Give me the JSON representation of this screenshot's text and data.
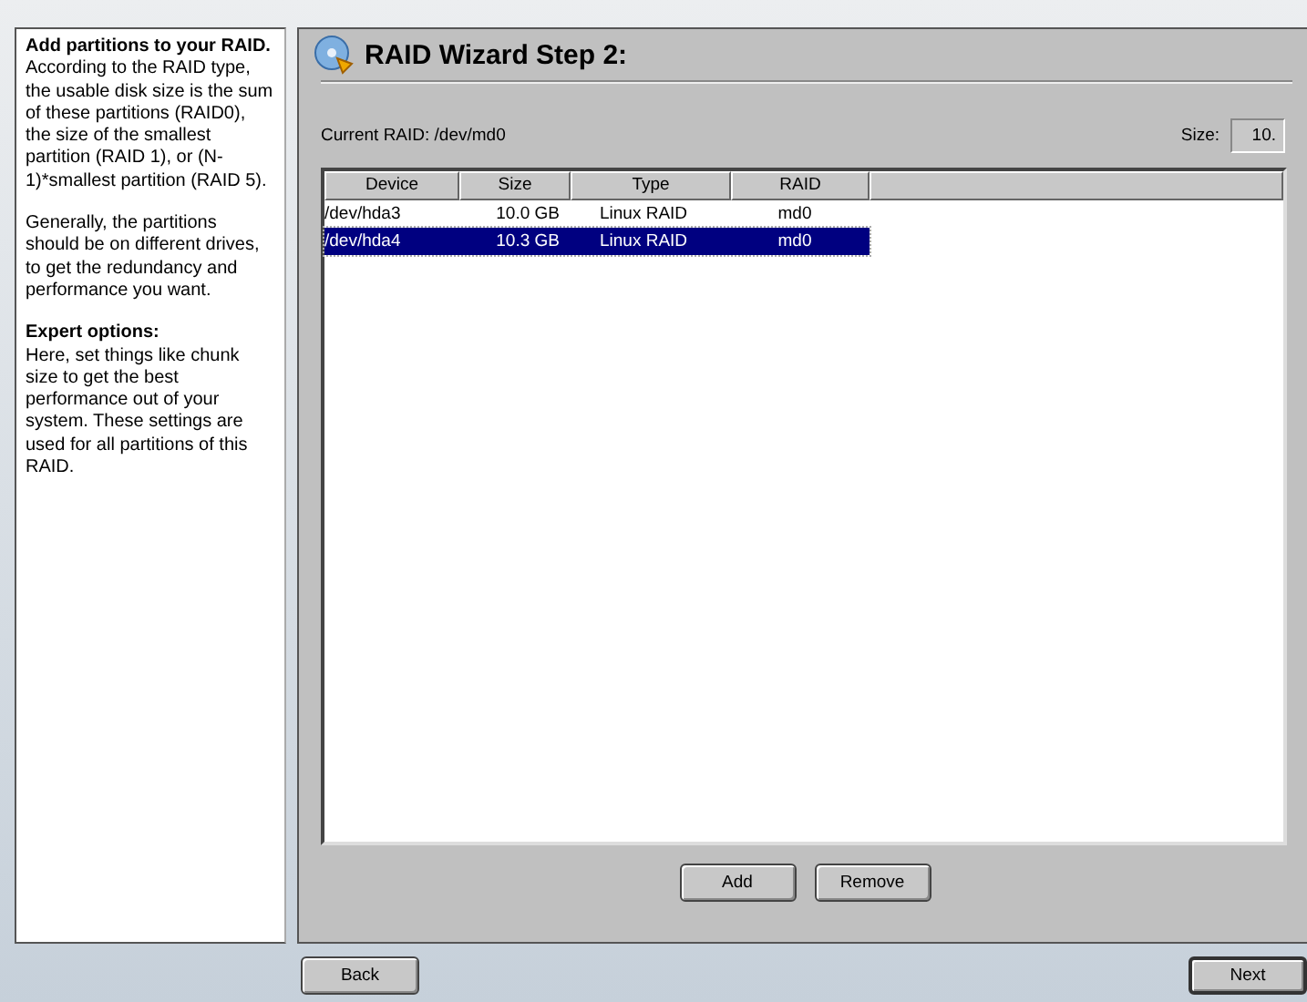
{
  "help": {
    "paragraphs": [
      "**Add partitions to your RAID.** According to the RAID type, the usable disk size is the sum of these partitions (RAID0), the size of the smallest partition (RAID 1), or (N-1)*smallest partition (RAID 5).",
      "Generally, the partitions should be on different drives, to get the redundancy and performance you want.",
      "**Expert options:**\nHere, set things like chunk size to get the best performance out of your system. These settings are used for all partitions of this RAID."
    ]
  },
  "title": "RAID Wizard Step 2:",
  "current_raid": "Current RAID: /dev/md0",
  "size": {
    "label": "Size:",
    "value": "10."
  },
  "table": {
    "columns": [
      "Device",
      "Size",
      "Type",
      "RAID"
    ],
    "rows": [
      {
        "cells": [
          "/dev/hda3",
          "10.0 GB",
          "Linux RAID",
          "md0"
        ],
        "selected": false
      },
      {
        "cells": [
          "/dev/hda4",
          "10.3 GB",
          "Linux RAID",
          "md0"
        ],
        "selected": true
      }
    ]
  },
  "actions": [
    "Add",
    "Remove"
  ],
  "nav": {
    "back": "Back",
    "next": "Next"
  }
}
